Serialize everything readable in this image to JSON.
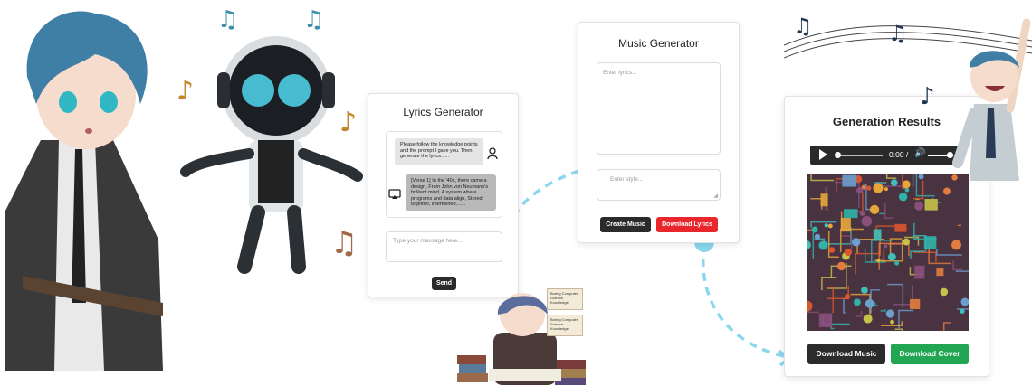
{
  "lyrics_card": {
    "title": "Lyrics Generator",
    "user_message": "Please follow the knowledge points and the prompt I gave you. Then, generate the lyrics......",
    "bot_message": "[Verse 1] In the '40s, there came a design, From John von Neumann's brilliant mind, A system where programs and data align, Stored together, intertwined.......",
    "input_placeholder": "Type your massage here...",
    "send_label": "Send"
  },
  "music_card": {
    "title": "Music Generator",
    "lyrics_placeholder": "Enter lyrics...",
    "style_placeholder": "Enter style...",
    "create_label": "Create Music",
    "download_lyrics_label": "Download Lyrics"
  },
  "results_card": {
    "title": "Generation Results",
    "time_display": "0:00 /",
    "playback_fraction": 0.0,
    "volume_fraction": 0.85,
    "download_music_label": "Download Music",
    "download_cover_label": "Download Cover"
  },
  "notes": [
    "Boring Computer Science Knowledge",
    "Boring Computer Science Knowledge"
  ],
  "colors": {
    "dark_button": "#2b2b2b",
    "red_button": "#e8262b",
    "green_button": "#22a653",
    "audio_bar": "#2a2a2a",
    "connector": "#8ad8ef"
  }
}
